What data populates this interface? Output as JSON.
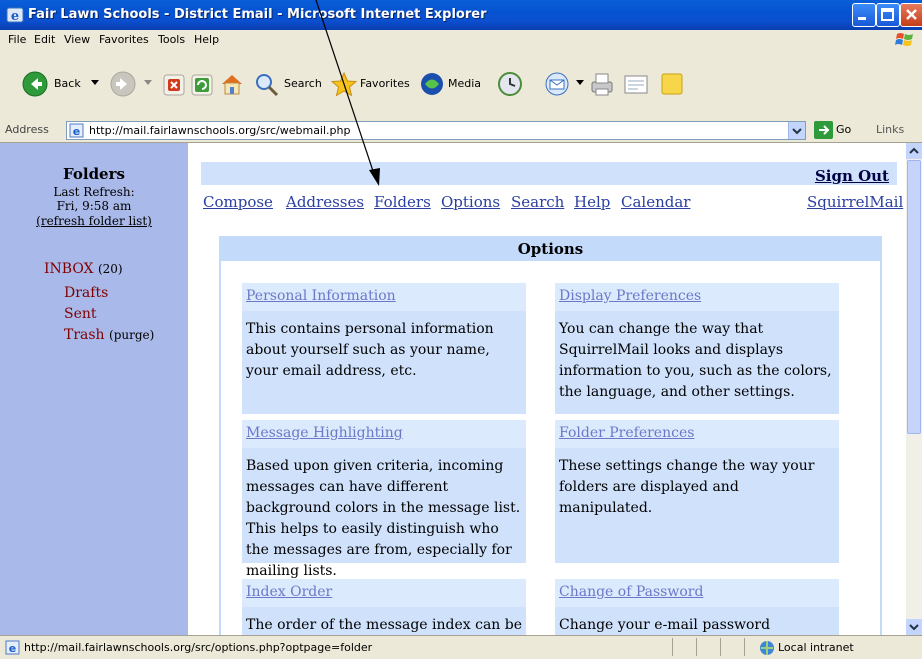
{
  "window": {
    "title": "Fair Lawn Schools - District Email - Microsoft Internet Explorer"
  },
  "menu": [
    "File",
    "Edit",
    "View",
    "Favorites",
    "Tools",
    "Help"
  ],
  "toolbar": {
    "back": "Back",
    "search": "Search",
    "favorites": "Favorites",
    "media": "Media"
  },
  "address": {
    "label": "Address",
    "url": "http://mail.fairlawnschools.org/src/webmail.php",
    "go": "Go",
    "links": "Links"
  },
  "sidebar": {
    "title": "Folders",
    "last_refresh": "Last Refresh:",
    "refresh_time": "Fri, 9:58 am",
    "refresh_link": "(refresh folder list)",
    "inbox": "INBOX",
    "inbox_count": "(20)",
    "drafts": "Drafts",
    "sent": "Sent",
    "trash": "Trash",
    "purge": "(purge)"
  },
  "top": {
    "sign_out": "Sign Out",
    "nav": [
      "Compose",
      "Addresses",
      "Folders",
      "Options",
      "Search",
      "Help",
      "Calendar"
    ],
    "brand": "SquirrelMail"
  },
  "options": {
    "title": "Options",
    "items": [
      {
        "title": "Personal Information",
        "desc": "This contains personal information about yourself such as your name, your email address, etc."
      },
      {
        "title": "Display Preferences",
        "desc": "You can change the way that SquirrelMail looks and displays information to you, such as the colors, the language, and other settings."
      },
      {
        "title": "Message Highlighting",
        "desc": "Based upon given criteria, incoming messages can have different background colors in the message list. This helps to easily distinguish who the messages are from, especially for mailing lists."
      },
      {
        "title": "Folder Preferences",
        "desc": "These settings change the way your folders are displayed and manipulated."
      },
      {
        "title": "Index Order",
        "desc": "The order of the message index can be"
      },
      {
        "title": "Change of Password",
        "desc": "Change your e-mail password"
      }
    ]
  },
  "status": {
    "text": "http://mail.fairlawnschools.org/src/options.php?optpage=folder",
    "zone": "Local intranet"
  }
}
